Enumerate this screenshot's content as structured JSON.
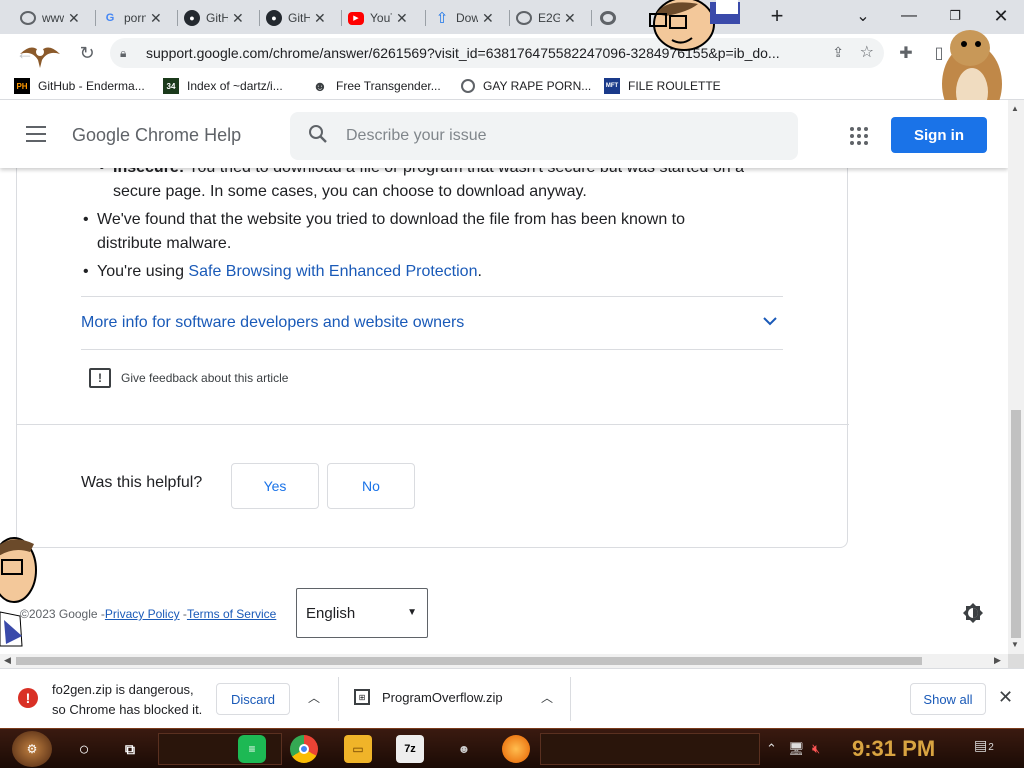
{
  "browser": {
    "tabs": [
      {
        "label": "www",
        "icon": "globe-icon",
        "color": "#5f6368"
      },
      {
        "label": "porn",
        "icon": "google-icon",
        "color": "#4285f4"
      },
      {
        "label": "GitHub",
        "icon": "github-icon",
        "color": "#24292f"
      },
      {
        "label": "GitHub",
        "icon": "github-icon",
        "color": "#24292f"
      },
      {
        "label": "YouTube",
        "icon": "youtube-icon",
        "color": "#ff0000"
      },
      {
        "label": "Download",
        "icon": "upload-arrow-icon",
        "color": "#1a73e8"
      },
      {
        "label": "E2G",
        "icon": "globe-icon",
        "color": "#5f6368"
      },
      {
        "label": "",
        "icon": "chrome-icon",
        "color": "#5f6368"
      }
    ],
    "url": "support.google.com/chrome/answer/6261569?visit_id=638176475582247096-3284976155&p=ib_do...",
    "bookmarks": [
      {
        "label": "GitHub - Enderma...",
        "icon": "PH"
      },
      {
        "label": "Index of ~dartz/i...",
        "icon": "34"
      },
      {
        "label": "Free Transgender...",
        "icon": "mask"
      },
      {
        "label": "GAY RAPE PORN...",
        "icon": "globe"
      },
      {
        "label": "FILE ROULETTE",
        "icon": "MFT"
      }
    ]
  },
  "help": {
    "title": "Google Chrome Help",
    "search_placeholder": "Describe your issue",
    "sign_in": "Sign in"
  },
  "article": {
    "insecure_bold": "Insecure:",
    "insecure_text": " You tried to download a file or program that wasn't secure but was started on a",
    "insecure_text2": "secure page. In some cases, you can choose to download anyway.",
    "malware_line1": "We've found that the website you tried to download the file from has been known to",
    "malware_line2": "distribute malware.",
    "safe_prefix": "You're using ",
    "safe_link": "Safe Browsing with Enhanced Protection",
    "safe_suffix": ".",
    "more_info": "More info for software developers and website owners",
    "feedback": "Give feedback about this article",
    "helpful_q": "Was this helpful?",
    "yes": "Yes",
    "no": "No"
  },
  "footer": {
    "copyright": "©2023 Google -",
    "privacy": "Privacy Policy",
    "sep": " -",
    "terms": "Terms of Service",
    "language": "English"
  },
  "downloads": {
    "danger_line1": "fo2gen.zip is dangerous,",
    "danger_line2": "so Chrome has blocked it.",
    "discard": "Discard",
    "file2": "ProgramOverflow.zip",
    "show_all": "Show all"
  },
  "taskbar": {
    "time": "9:31 PM",
    "notifications": "2"
  }
}
